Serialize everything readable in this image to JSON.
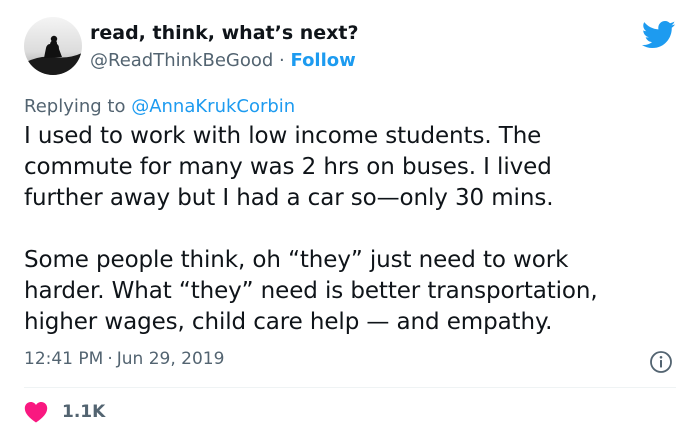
{
  "author": {
    "display_name": "read, think, what’s next?",
    "handle": "@ReadThinkBeGood",
    "separator": "·",
    "follow_label": "Follow"
  },
  "reply": {
    "prefix": "Replying to ",
    "handle": "@AnnaKrukCorbin"
  },
  "tweet": {
    "text": "I used to work with low income students. The\ncommute for many was 2 hrs on buses. I lived\nfurther away but I had a car so—only 30 mins.\n\nSome people think, oh “they” just need to work\nharder. What “they” need is better transportation,\nhigher wages, child care help — and empathy.",
    "time": "12:41 PM",
    "separator": "·",
    "date": "Jun 29, 2019"
  },
  "stats": {
    "likes": "1.1K"
  },
  "icons": {
    "brand": "twitter-bird-icon",
    "info": "info-icon",
    "like": "heart-icon"
  },
  "colors": {
    "accent": "#1d9bf0",
    "like": "#f91880",
    "secondary_text": "#536471",
    "primary_text": "#0f1419"
  }
}
